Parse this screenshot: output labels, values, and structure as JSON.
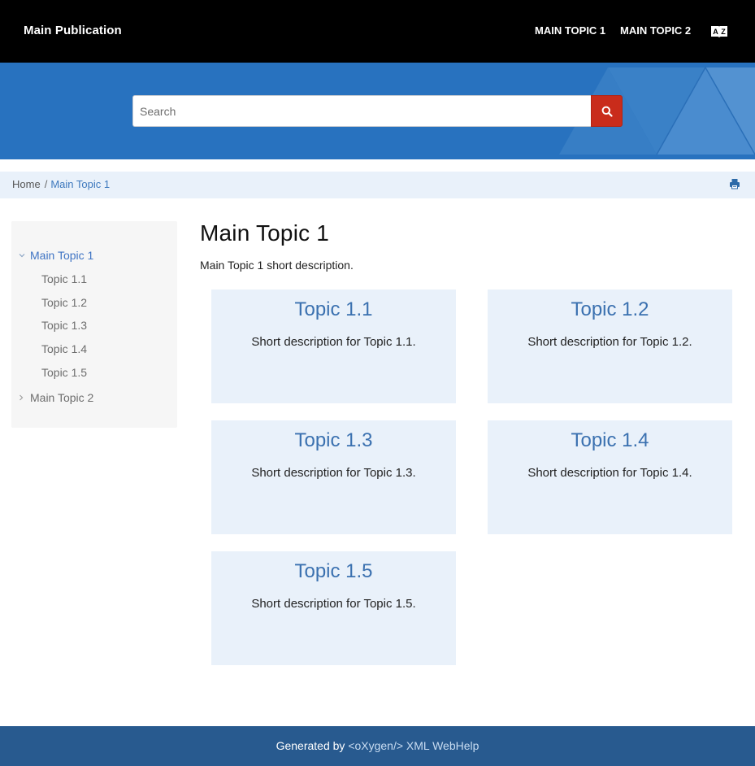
{
  "header": {
    "brand": "Main Publication",
    "nav": [
      {
        "label": "MAIN TOPIC 1"
      },
      {
        "label": "MAIN TOPIC 2"
      }
    ],
    "language_icon": "book-az-icon"
  },
  "search": {
    "placeholder": "Search",
    "value": "",
    "button_icon": "search-icon"
  },
  "breadcrumb": {
    "home": "Home",
    "separator": "/",
    "current": "Main Topic 1",
    "print_icon": "print-icon"
  },
  "toc": {
    "items": [
      {
        "label": "Main Topic 1",
        "expanded": true,
        "active": true
      },
      {
        "label": "Topic 1.1"
      },
      {
        "label": "Topic 1.2"
      },
      {
        "label": "Topic 1.3"
      },
      {
        "label": "Topic 1.4"
      },
      {
        "label": "Topic 1.5"
      },
      {
        "label": "Main Topic 2",
        "expanded": false
      }
    ]
  },
  "main": {
    "title": "Main Topic 1",
    "description": "Main Topic 1 short description.",
    "cards": [
      {
        "title": "Topic 1.1",
        "description": "Short description for Topic 1.1."
      },
      {
        "title": "Topic 1.2",
        "description": "Short description for Topic 1.2."
      },
      {
        "title": "Topic 1.3",
        "description": "Short description for Topic 1.3."
      },
      {
        "title": "Topic 1.4",
        "description": "Short description for Topic 1.4."
      },
      {
        "title": "Topic 1.5",
        "description": "Short description for Topic 1.5."
      }
    ]
  },
  "footer": {
    "prefix": "Generated by ",
    "link": "<oXygen/> XML WebHelp"
  },
  "colors": {
    "header_bg": "#000000",
    "hero_bg": "#2872bf",
    "search_button": "#c92c1b",
    "card_bg": "#e9f1fa",
    "link": "#3d78bd",
    "footer_bg": "#285a8f"
  }
}
